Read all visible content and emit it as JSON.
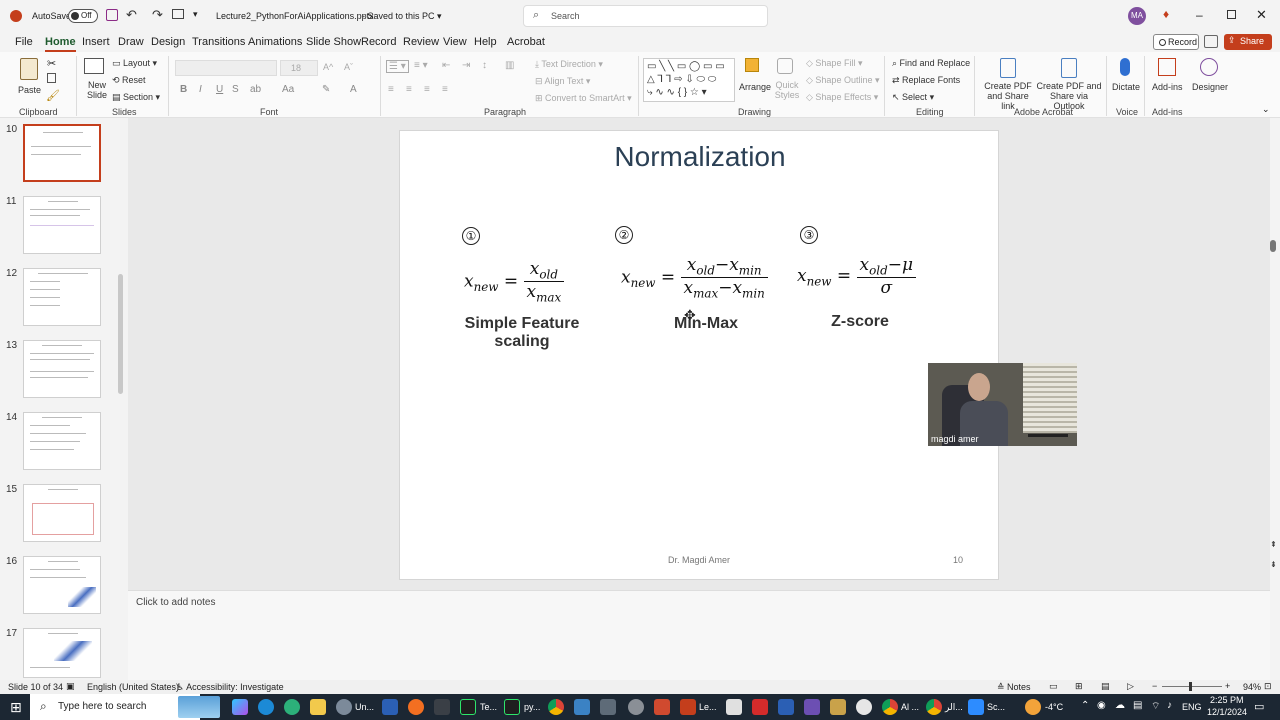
{
  "titlebar": {
    "autosave_label": "AutoSave",
    "autosave_state": "Off",
    "filename": "Lecture2_PythonForAiApplications.pptx",
    "save_status": "Saved to this PC",
    "search_placeholder": "Search",
    "user_initials": "MA"
  },
  "menu": {
    "tabs": [
      "File",
      "Home",
      "Insert",
      "Draw",
      "Design",
      "Transitions",
      "Animations",
      "Slide Show",
      "Record",
      "Review",
      "View",
      "Help",
      "Acrobat"
    ],
    "active": "Home",
    "record_button": "Record",
    "share_button": "Share"
  },
  "ribbon": {
    "clipboard": {
      "paste": "Paste",
      "group": "Clipboard"
    },
    "slides": {
      "new_slide": "New Slide",
      "layout": "Layout",
      "reset": "Reset",
      "section": "Section",
      "group": "Slides"
    },
    "font": {
      "size": "18",
      "group": "Font"
    },
    "paragraph": {
      "text_direction": "Text Direction",
      "align_text": "Align Text",
      "convert": "Convert to SmartArt",
      "group": "Paragraph"
    },
    "drawing": {
      "arrange": "Arrange",
      "quick_styles": "Quick Styles",
      "shape_fill": "Shape Fill",
      "shape_outline": "Shape Outline",
      "shape_effects": "Shape Effects",
      "group": "Drawing"
    },
    "editing": {
      "find_replace": "Find and Replace",
      "replace_fonts": "Replace Fonts",
      "select": "Select",
      "group": "Editing"
    },
    "acrobat": {
      "create_pdf": "Create PDF and Share link",
      "create_pdf_outlook": "Create PDF and Share via Outlook",
      "group": "Adobe Acrobat"
    },
    "voice": {
      "dictate": "Dictate",
      "group": "Voice"
    },
    "addins": {
      "addins": "Add-ins",
      "group": "Add-ins"
    },
    "designer": {
      "label": "Designer"
    }
  },
  "thumbnails": {
    "numbers": [
      "10",
      "11",
      "12",
      "13",
      "14",
      "15",
      "16",
      "17"
    ],
    "selected": "10"
  },
  "slide": {
    "title": "Normalization",
    "methods": [
      {
        "number": "①",
        "caption_line1": "Simple Feature",
        "caption_line2": "scaling"
      },
      {
        "number": "②",
        "caption_line1": "Min-Max",
        "caption_line2": ""
      },
      {
        "number": "③",
        "caption_line1": "Z-score",
        "caption_line2": ""
      }
    ],
    "footer": "Dr. Magdi Amer",
    "page_number": "10"
  },
  "webcam": {
    "name": "magdi amer"
  },
  "notes_placeholder": "Click to add notes",
  "status": {
    "slide_count": "Slide 10 of 34",
    "language": "English (United States)",
    "accessibility": "Accessibility: Investigate",
    "notes": "Notes",
    "zoom": "94%"
  },
  "taskbar": {
    "search_placeholder": "Type here to search",
    "app_labels": [
      "Un...",
      "Te...",
      "py...",
      "Le...",
      "Al ...",
      "الر...",
      "Sc..."
    ],
    "temperature": "-4°C",
    "lang": "ENG",
    "time": "2:25 PM",
    "date": "12/1/2024"
  }
}
